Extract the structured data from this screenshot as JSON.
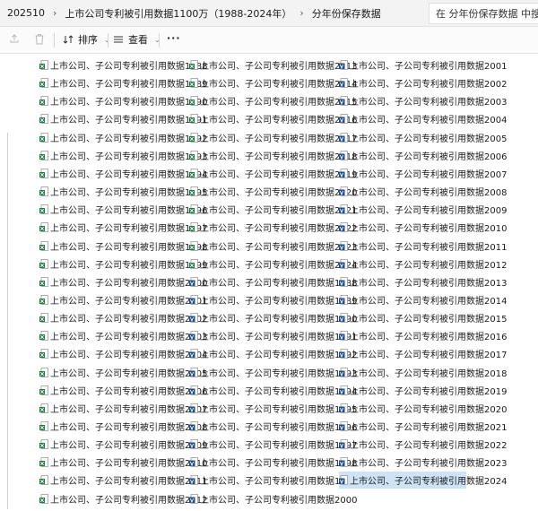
{
  "breadcrumb": [
    "202510",
    "上市公司专利被引用数据1100万（1988-2024年）",
    "分年份保存数据"
  ],
  "search": {
    "placeholder": "在 分年份保存数据 中搜索"
  },
  "toolbar": {
    "sort_label": "排序",
    "view_label": "查看",
    "more_label": "···"
  },
  "colors": {
    "selected": "#cfe3f7",
    "csv_icon": "#1f7a45",
    "doc_icon": "#1f4f8a"
  },
  "files": {
    "col1": [
      "上市公司、子公司专利被引用数据1988",
      "上市公司、子公司专利被引用数据1989",
      "上市公司、子公司专利被引用数据1990",
      "上市公司、子公司专利被引用数据1991",
      "上市公司、子公司专利被引用数据1992",
      "上市公司、子公司专利被引用数据1993",
      "上市公司、子公司专利被引用数据1994",
      "上市公司、子公司专利被引用数据1995",
      "上市公司、子公司专利被引用数据1996",
      "上市公司、子公司专利被引用数据1997",
      "上市公司、子公司专利被引用数据1998",
      "上市公司、子公司专利被引用数据1999",
      "上市公司、子公司专利被引用数据2000",
      "上市公司、子公司专利被引用数据2001",
      "上市公司、子公司专利被引用数据2002",
      "上市公司、子公司专利被引用数据2003",
      "上市公司、子公司专利被引用数据2004",
      "上市公司、子公司专利被引用数据2005",
      "上市公司、子公司专利被引用数据2006",
      "上市公司、子公司专利被引用数据2007",
      "上市公司、子公司专利被引用数据2008",
      "上市公司、子公司专利被引用数据2009",
      "上市公司、子公司专利被引用数据2010",
      "上市公司、子公司专利被引用数据2011",
      "上市公司、子公司专利被引用数据2012"
    ],
    "col2": [
      "上市公司、子公司专利被引用数据2013",
      "上市公司、子公司专利被引用数据2014",
      "上市公司、子公司专利被引用数据2015",
      "上市公司、子公司专利被引用数据2016",
      "上市公司、子公司专利被引用数据2017",
      "上市公司、子公司专利被引用数据2018",
      "上市公司、子公司专利被引用数据2019",
      "上市公司、子公司专利被引用数据2020",
      "上市公司、子公司专利被引用数据2021",
      "上市公司、子公司专利被引用数据2022",
      "上市公司、子公司专利被引用数据2023",
      "上市公司、子公司专利被引用数据2024",
      "上市公司、子公司专利被引用数据1988",
      "上市公司、子公司专利被引用数据1989",
      "上市公司、子公司专利被引用数据1990",
      "上市公司、子公司专利被引用数据1991",
      "上市公司、子公司专利被引用数据1992",
      "上市公司、子公司专利被引用数据1993",
      "上市公司、子公司专利被引用数据1994",
      "上市公司、子公司专利被引用数据1995",
      "上市公司、子公司专利被引用数据1996",
      "上市公司、子公司专利被引用数据1997",
      "上市公司、子公司专利被引用数据1998",
      "上市公司、子公司专利被引用数据1999",
      "上市公司、子公司专利被引用数据2000"
    ],
    "col3": [
      "上市公司、子公司专利被引用数据2001",
      "上市公司、子公司专利被引用数据2002",
      "上市公司、子公司专利被引用数据2003",
      "上市公司、子公司专利被引用数据2004",
      "上市公司、子公司专利被引用数据2005",
      "上市公司、子公司专利被引用数据2006",
      "上市公司、子公司专利被引用数据2007",
      "上市公司、子公司专利被引用数据2008",
      "上市公司、子公司专利被引用数据2009",
      "上市公司、子公司专利被引用数据2010",
      "上市公司、子公司专利被引用数据2011",
      "上市公司、子公司专利被引用数据2012",
      "上市公司、子公司专利被引用数据2013",
      "上市公司、子公司专利被引用数据2014",
      "上市公司、子公司专利被引用数据2015",
      "上市公司、子公司专利被引用数据2016",
      "上市公司、子公司专利被引用数据2017",
      "上市公司、子公司专利被引用数据2018",
      "上市公司、子公司专利被引用数据2019",
      "上市公司、子公司专利被引用数据2020",
      "上市公司、子公司专利被引用数据2021",
      "上市公司、子公司专利被引用数据2022",
      "上市公司、子公司专利被引用数据2023",
      "上市公司、子公司专利被引用数据2024"
    ],
    "col1_icon": "csv-file-icon",
    "col2_icon": "csv-file-icon for first 12 rows, document-file-icon after",
    "col3_icon": "document-file-icon",
    "selected_item": "col3.23"
  }
}
